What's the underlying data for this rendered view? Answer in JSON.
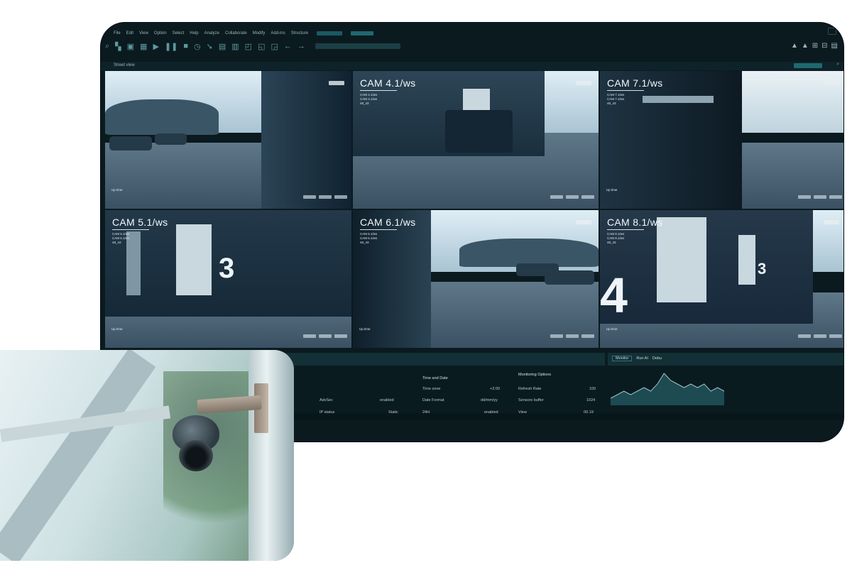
{
  "menu": {
    "items": [
      "File",
      "Edit",
      "View",
      "Option",
      "Select",
      "Help",
      "Analyze",
      "Collaborate",
      "Modify",
      "Add-ins",
      "Structure"
    ]
  },
  "toolbar": {
    "icons": [
      "zoom-icon",
      "layers-icon",
      "save-icon",
      "grid-icon",
      "play-icon",
      "pause-icon",
      "stop-icon",
      "clock-icon",
      "cursor-icon",
      "monitor-icon",
      "copy-icon",
      "window-icon",
      "window-icon",
      "window-icon",
      "arrow-left-icon",
      "arrow-right-icon"
    ],
    "right_icons": [
      "lock-icon",
      "lock-icon",
      "add-icon",
      "minus-icon",
      "menu-icon"
    ]
  },
  "tab": {
    "label": "Street view"
  },
  "cameras": [
    {
      "id": "cam-1",
      "title": "",
      "lines": [],
      "live": "Up time"
    },
    {
      "id": "cam-4",
      "title": "CAM 4.1/ws",
      "lines": [
        "CAM 4.1/ws",
        "CAM 4.1/ws",
        "48_43"
      ],
      "live": "Up time"
    },
    {
      "id": "cam-7",
      "title": "CAM 7.1/ws",
      "lines": [
        "CAM 7.1/ws",
        "CAM 7.1/ws",
        "48_43"
      ],
      "live": "Up time"
    },
    {
      "id": "cam-5",
      "title": "CAM 5.1/ws",
      "lines": [
        "CAM 5.1/ws",
        "CAM 5.1/ws",
        "48_43"
      ],
      "live": "Up time"
    },
    {
      "id": "cam-6",
      "title": "CAM 6.1/ws",
      "lines": [
        "CAM 6.1/ws",
        "CAM 6.1/ws",
        "48_43"
      ],
      "live": "Up time"
    },
    {
      "id": "cam-8",
      "title": "CAM 8.1/ws",
      "lines": [
        "CAM 8.1/ws",
        "CAM 8.1/ws",
        "48_43"
      ],
      "live": "Up time"
    }
  ],
  "panel": {
    "left_labels": [
      "AdvSec",
      "IP status"
    ],
    "left_values": [
      "enabled",
      "Static"
    ],
    "time_head": "Time and Date",
    "time_rows": [
      {
        "k": "Time zone",
        "v": "+2:00"
      },
      {
        "k": "Date Format",
        "v": "dd/mm/yy"
      },
      {
        "k": "24H",
        "v": "enabled"
      }
    ],
    "mon_head": "Monitoring Options",
    "mon_rows": [
      {
        "k": "Refresh Rate",
        "v": "100"
      },
      {
        "k": "Sensors buffer",
        "v": "1024"
      },
      {
        "k": "View",
        "v": "00.19"
      }
    ],
    "tabs": [
      "Monitor",
      "Run AI",
      "Debu"
    ]
  },
  "chart_data": {
    "type": "area",
    "series": [
      {
        "values": [
          2,
          3,
          4,
          3,
          4,
          5,
          4,
          6,
          9,
          7,
          6,
          5,
          6,
          5,
          6,
          4,
          5,
          4
        ]
      }
    ]
  },
  "colors": {
    "accent": "#1f6871",
    "bg": "#0b1a1f",
    "panel": "#123036"
  }
}
